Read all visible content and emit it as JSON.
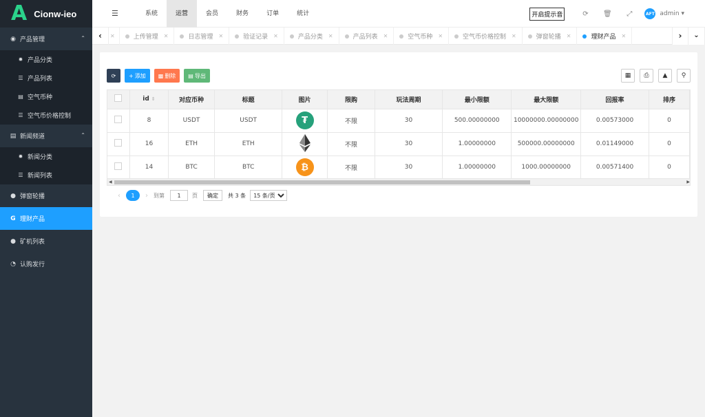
{
  "app": {
    "logo_letter": "A",
    "name": "Cionw-ieo"
  },
  "sidebar": {
    "groups": [
      {
        "label": "产品管理",
        "icon": "product-icon",
        "expanded": true,
        "items": [
          {
            "label": "产品分类",
            "icon": "gear-icon"
          },
          {
            "label": "产品列表",
            "icon": "list-icon"
          },
          {
            "label": "空气币种",
            "icon": "bill-icon"
          },
          {
            "label": "空气币价格控制",
            "icon": "list-icon"
          }
        ]
      },
      {
        "label": "新闻频道",
        "icon": "news-icon",
        "expanded": true,
        "items": [
          {
            "label": "新闻分类",
            "icon": "gear-icon"
          },
          {
            "label": "新闻列表",
            "icon": "list-icon"
          }
        ]
      }
    ],
    "singles": [
      {
        "label": "弹窗轮播",
        "icon": "popup-icon"
      },
      {
        "label": "理财产品",
        "icon": "finance-icon",
        "active": true
      },
      {
        "label": "矿机列表",
        "icon": "miner-icon"
      },
      {
        "label": "认购发行",
        "icon": "pie-icon"
      }
    ]
  },
  "topnav": {
    "items": [
      "系统",
      "运营",
      "会员",
      "财务",
      "订单",
      "统计"
    ],
    "active": "运营",
    "sound_button": "开启提示音",
    "user": "admin",
    "avatar_text": "AFT"
  },
  "tabs": [
    "上传管理",
    "日志管理",
    "验证记录",
    "产品分类",
    "产品列表",
    "空气币种",
    "空气币价格控制",
    "弹窗轮播",
    "理财产品"
  ],
  "active_tab": "理财产品",
  "toolbar": {
    "add": "添加",
    "delete": "删除",
    "export": "导出"
  },
  "table": {
    "headers": [
      "id",
      "对应币种",
      "标题",
      "图片",
      "限购",
      "玩法周期",
      "最小限额",
      "最大限额",
      "回报率",
      "排序"
    ],
    "rows": [
      {
        "id": "8",
        "coin": "USDT",
        "title": "USDT",
        "limit": "不限",
        "cycle": "30",
        "min": "500.00000000",
        "max": "10000000.00000000",
        "rate": "0.00573000",
        "sort": "0",
        "logo_color": "#26a17b",
        "logo": "tether-logo"
      },
      {
        "id": "16",
        "coin": "ETH",
        "title": "ETH",
        "limit": "不限",
        "cycle": "30",
        "min": "1.00000000",
        "max": "500000.00000000",
        "rate": "0.01149000",
        "sort": "0",
        "logo_color": "#343434",
        "logo": "ethereum-logo"
      },
      {
        "id": "14",
        "coin": "BTC",
        "title": "BTC",
        "limit": "不限",
        "cycle": "30",
        "min": "1.00000000",
        "max": "1000.00000000",
        "rate": "0.00571400",
        "sort": "0",
        "logo_color": "#f7931a",
        "logo": "bitcoin-logo"
      }
    ]
  },
  "pager": {
    "current": "1",
    "goto_label": "到第",
    "goto_value": "1",
    "page_unit": "页",
    "confirm": "确定",
    "total": "共 3 条",
    "size": "15 条/页"
  }
}
